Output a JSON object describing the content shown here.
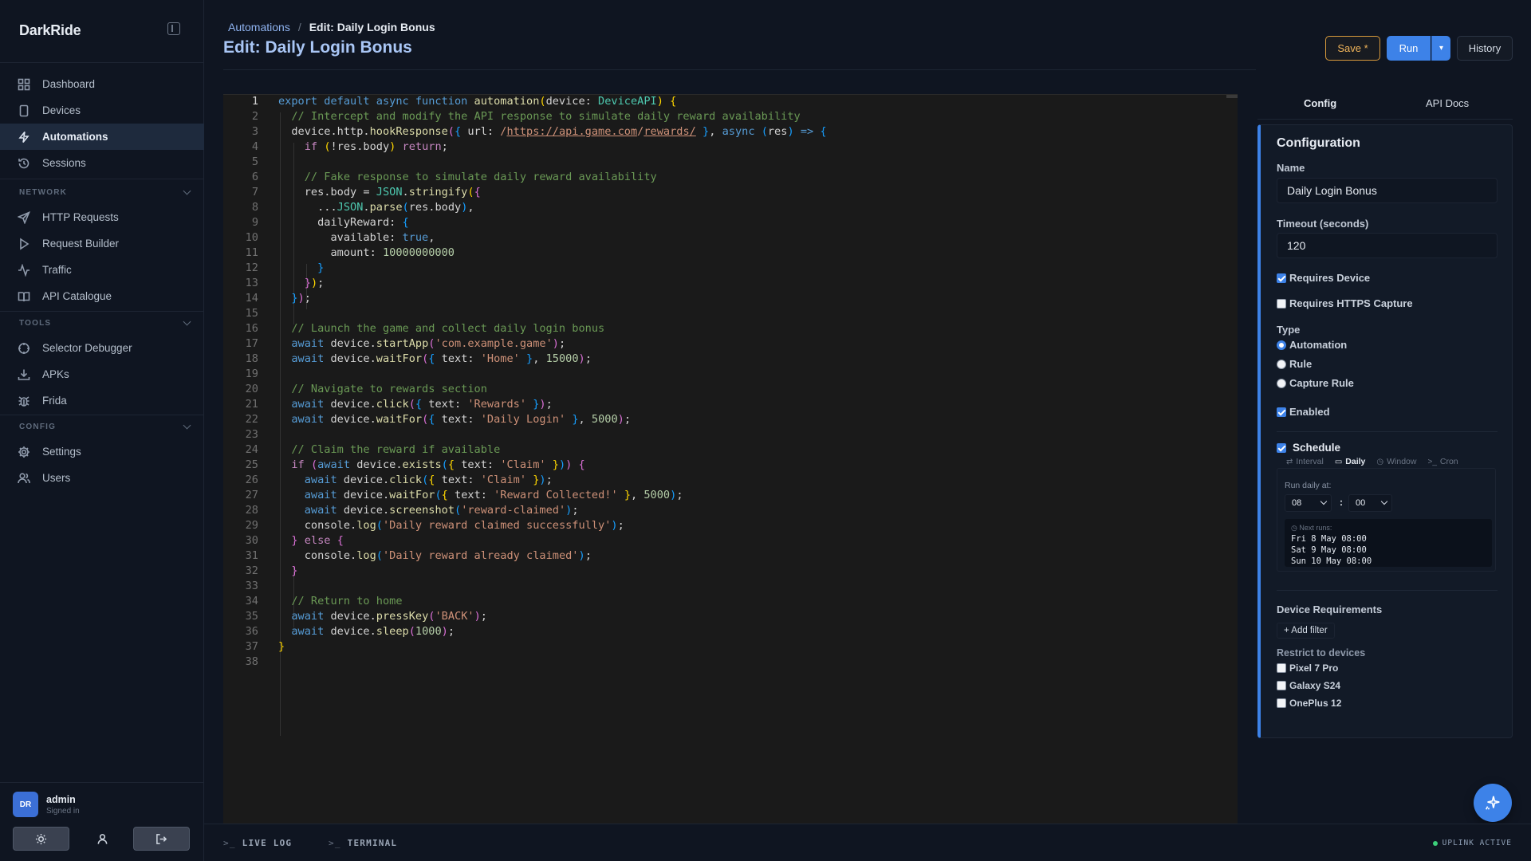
{
  "app": {
    "brand": "DarkRide"
  },
  "sidebar": {
    "main_items": [
      {
        "label": "Dashboard",
        "icon": "dashboard-icon"
      },
      {
        "label": "Devices",
        "icon": "device-icon"
      },
      {
        "label": "Automations",
        "icon": "bolt-icon",
        "active": true
      },
      {
        "label": "Sessions",
        "icon": "history-icon"
      }
    ],
    "network_label": "NETWORK",
    "network_items": [
      {
        "label": "HTTP Requests",
        "icon": "send-icon"
      },
      {
        "label": "Request Builder",
        "icon": "play-icon"
      },
      {
        "label": "Traffic",
        "icon": "activity-icon"
      },
      {
        "label": "API Catalogue",
        "icon": "book-icon"
      }
    ],
    "tools_label": "TOOLS",
    "tools_items": [
      {
        "label": "Selector Debugger",
        "icon": "crosshair-icon"
      },
      {
        "label": "APKs",
        "icon": "download-icon"
      },
      {
        "label": "Frida",
        "icon": "bug-icon"
      }
    ],
    "config_label": "CONFIG",
    "config_items": [
      {
        "label": "Settings",
        "icon": "gear-icon"
      },
      {
        "label": "Users",
        "icon": "users-icon"
      }
    ],
    "user": {
      "initials": "DR",
      "name": "admin",
      "status": "Signed in"
    }
  },
  "header": {
    "breadcrumb_root": "Automations",
    "breadcrumb_sep": "/",
    "breadcrumb_current": "Edit: Daily Login Bonus",
    "title": "Edit: Daily Login Bonus",
    "save_label": "Save *",
    "run_label": "Run",
    "run_menu_label": "▾",
    "history_label": "History"
  },
  "editor": {
    "current_line": 1,
    "line_count": 38
  },
  "panel": {
    "tabs": [
      "Config",
      "API Docs"
    ],
    "title": "Configuration",
    "name_label": "Name",
    "name_value": "Daily Login Bonus",
    "timeout_label": "Timeout (seconds)",
    "timeout_value": "120",
    "requires_device": {
      "label": "Requires Device",
      "checked": true
    },
    "requires_https": {
      "label": "Requires HTTPS Capture",
      "checked": false
    },
    "type_label": "Type",
    "type_options": [
      {
        "label": "Automation",
        "selected": true
      },
      {
        "label": "Rule",
        "selected": false
      },
      {
        "label": "Capture Rule",
        "selected": false
      }
    ],
    "enabled": {
      "label": "Enabled",
      "checked": true
    },
    "schedule": {
      "label": "Schedule",
      "checked": true,
      "tabs": [
        {
          "label": "Interval",
          "icon": "⇄"
        },
        {
          "label": "Daily",
          "icon": "▭",
          "active": true
        },
        {
          "label": "Window",
          "icon": "◷"
        },
        {
          "label": "Cron",
          "icon": ">_"
        }
      ],
      "run_daily_label": "Run daily at:",
      "hour": "08",
      "colon": ":",
      "minute": "00",
      "next_runs_label": "◷ Next runs:",
      "next_runs": [
        "Fri 8 May 08:00",
        "Sat 9 May 08:00",
        "Sun 10 May 08:00"
      ]
    },
    "device_requirements_label": "Device Requirements",
    "add_filter_label": "+ Add filter",
    "restrict_label": "Restrict to devices",
    "devices": [
      {
        "label": "Pixel 7 Pro",
        "checked": false
      },
      {
        "label": "Galaxy S24",
        "checked": false
      },
      {
        "label": "OnePlus 12",
        "checked": false
      }
    ]
  },
  "bottom": {
    "live_log_prompt": ">_",
    "live_log": "LIVE LOG",
    "terminal_prompt": ">_",
    "terminal": "TERMINAL",
    "uplink": "UPLINK ACTIVE"
  },
  "colors": {
    "accent": "#3d82e8",
    "save": "#d89a3c",
    "status_ok": "#3ccf7a"
  }
}
